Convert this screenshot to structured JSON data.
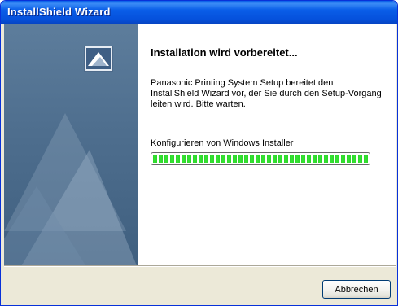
{
  "window": {
    "title": "InstallShield Wizard"
  },
  "main": {
    "heading": "Installation wird vorbereitet...",
    "description": "Panasonic Printing System Setup bereitet den InstallShield Wizard vor, der Sie durch den Setup-Vorgang leiten wird. Bitte warten.",
    "status_text": "Konfigurieren von Windows Installer",
    "progress_fraction": 1.0
  },
  "footer": {
    "cancel_label": "Abbrechen"
  },
  "icons": {
    "logo": "installshield-logo-icon"
  },
  "colors": {
    "titlebar": "#0a5ee8",
    "panel": "#4e6e8e",
    "dialog_bg": "#ece9d8",
    "progress_fill": "#2bd428"
  }
}
